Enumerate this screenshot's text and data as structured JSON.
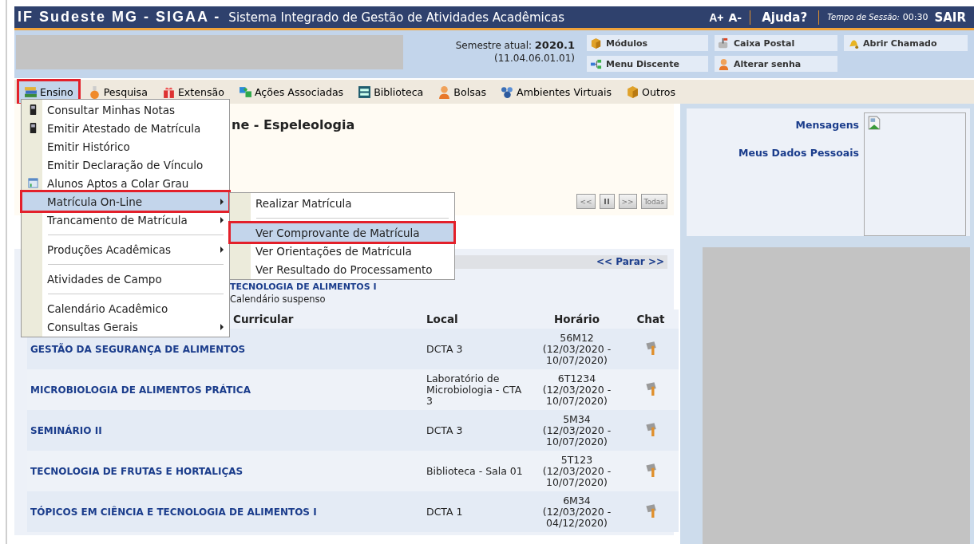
{
  "header": {
    "title": "IF Sudeste MG - SIGAA -",
    "subtitle": "Sistema Integrado de Gestão de Atividades Acadêmicas",
    "font_up": "A+",
    "font_down": "A-",
    "help": "Ajuda?",
    "session_label": "Tempo de Sessão:",
    "session_time": "00:30",
    "logout": "SAIR"
  },
  "info": {
    "semester_label": "Semestre atual:",
    "semester": "2020.1",
    "code": "(11.04.06.01.01)"
  },
  "shortcuts": [
    {
      "label": "Módulos",
      "kind": "box"
    },
    {
      "label": "Caixa Postal",
      "kind": "mailbox"
    },
    {
      "label": "Abrir Chamado",
      "kind": "bell"
    },
    {
      "label": "Menu Discente",
      "kind": "tree"
    },
    {
      "label": "Alterar senha",
      "kind": "person"
    }
  ],
  "menu": [
    {
      "label": "Ensino",
      "kind": "books",
      "selected": true,
      "highlighted": true
    },
    {
      "label": "Pesquisa",
      "kind": "flask",
      "selected": false,
      "highlighted": false
    },
    {
      "label": "Extensão",
      "kind": "gift",
      "selected": false,
      "highlighted": false
    },
    {
      "label": "Ações Associadas",
      "kind": "puzzle",
      "selected": false,
      "highlighted": false
    },
    {
      "label": "Biblioteca",
      "kind": "shelf",
      "selected": false,
      "highlighted": false
    },
    {
      "label": "Bolsas",
      "kind": "person",
      "selected": false,
      "highlighted": false
    },
    {
      "label": "Ambientes Virtuais",
      "kind": "network",
      "selected": false,
      "highlighted": false
    },
    {
      "label": "Outros",
      "kind": "box",
      "selected": false,
      "highlighted": false
    }
  ],
  "dropdown": [
    {
      "kind": "phone",
      "label": "Consultar Minhas Notas",
      "has_submenu": false,
      "selected": false,
      "highlighted": false
    },
    {
      "kind": "phone",
      "label": "Emitir Atestado de Matrícula",
      "has_submenu": false,
      "selected": false,
      "highlighted": false
    },
    {
      "kind": "item",
      "label": "Emitir Histórico",
      "has_submenu": false,
      "selected": false,
      "highlighted": false
    },
    {
      "kind": "item",
      "label": "Emitir Declaração de Vínculo",
      "has_submenu": false,
      "selected": false,
      "highlighted": false
    },
    {
      "kind": "chart",
      "label": "Alunos Aptos a Colar Grau",
      "has_submenu": false,
      "selected": false,
      "highlighted": false
    },
    {
      "kind": "item",
      "label": "Matrícula On-Line",
      "has_submenu": true,
      "selected": true,
      "highlighted": true
    },
    {
      "kind": "item",
      "label": "Trancamento de Matrícula",
      "has_submenu": true,
      "selected": false,
      "highlighted": false
    },
    {
      "kind": "separator"
    },
    {
      "kind": "item",
      "label": "Produções Acadêmicas",
      "has_submenu": true,
      "selected": false,
      "highlighted": false
    },
    {
      "kind": "separator"
    },
    {
      "kind": "item",
      "label": "Atividades de Campo",
      "has_submenu": false,
      "selected": false,
      "highlighted": false
    },
    {
      "kind": "separator"
    },
    {
      "kind": "item",
      "label": "Calendário Acadêmico",
      "has_submenu": false,
      "selected": false,
      "highlighted": false
    },
    {
      "kind": "item",
      "label": "Consultas Gerais",
      "has_submenu": true,
      "selected": false,
      "highlighted": false
    }
  ],
  "submenu": [
    {
      "kind": "item",
      "label": "Realizar Matrícula",
      "selected": false,
      "highlighted": false
    },
    {
      "kind": "separator"
    },
    {
      "kind": "item",
      "label": "Ver Comprovante de Matrícula",
      "selected": true,
      "highlighted": true
    },
    {
      "kind": "item",
      "label": "Ver Orientações de Matrícula",
      "selected": false,
      "highlighted": false
    },
    {
      "kind": "item",
      "label": "Ver Resultado do Processamento",
      "selected": false,
      "highlighted": false
    }
  ],
  "content": {
    "heading": "ne - Espeleologia",
    "controls": [
      {
        "kind": "prev",
        "label": "<<"
      },
      {
        "kind": "pause"
      },
      {
        "kind": "next",
        "label": ">>"
      },
      {
        "kind": "all",
        "label": "Todas"
      }
    ],
    "stop": "<< Parar >>",
    "course": "TECNOLOGIA DE ALIMENTOS I",
    "note": "Calendário suspenso"
  },
  "table": {
    "columns": [
      "Curricular",
      "Local",
      "Horário",
      "Chat"
    ],
    "rows": [
      {
        "component": "GESTÃO DA SEGURANÇA DE ALIMENTOS",
        "local": "DCTA 3",
        "schedule": "56M12",
        "period": "(12/03/2020 - 10/07/2020)"
      },
      {
        "component": "MICROBIOLOGIA DE ALIMENTOS PRÁTICA",
        "local": "Laboratório de Microbiologia - CTA 3",
        "schedule": "6T1234",
        "period": "(12/03/2020 - 10/07/2020)"
      },
      {
        "component": "SEMINÁRIO II",
        "local": "DCTA 3",
        "schedule": "5M34",
        "period": "(12/03/2020 - 10/07/2020)"
      },
      {
        "component": "TECNOLOGIA DE FRUTAS E HORTALIÇAS",
        "local": "Biblioteca - Sala 01",
        "schedule": "5T123",
        "period": "(12/03/2020 - 10/07/2020)"
      },
      {
        "component": "TÓPICOS EM CIÊNCIA E TECNOLOGIA DE ALIMENTOS I",
        "local": "DCTA 1",
        "schedule": "6M34",
        "period": "(12/03/2020 - 04/12/2020)"
      }
    ]
  },
  "side": {
    "links": [
      "Mensagens",
      "Meus Dados Pessoais"
    ]
  }
}
